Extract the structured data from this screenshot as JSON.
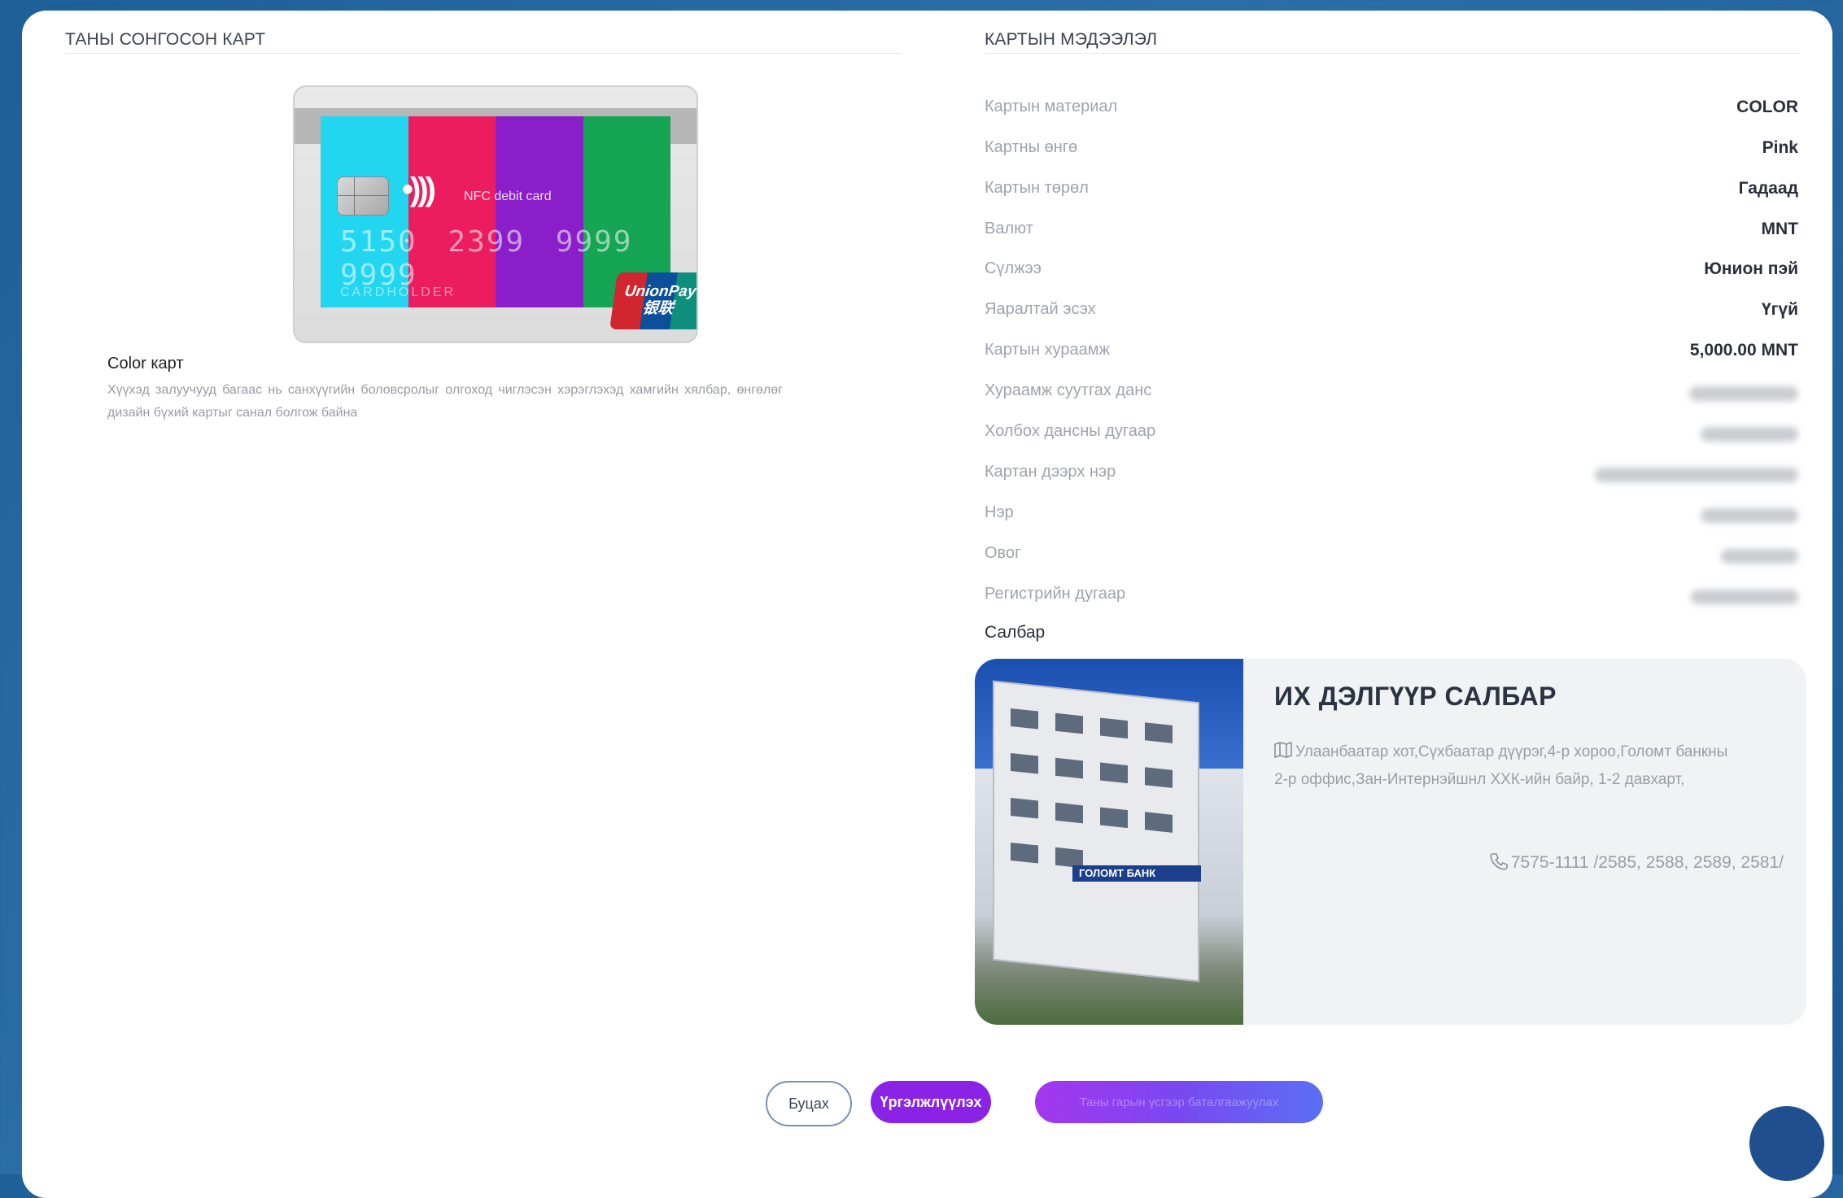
{
  "left_section": {
    "title": "ТАНЫ СОНГОСОН КАРТ",
    "card": {
      "number_groups": [
        "5150",
        "2399",
        "9999",
        "9999"
      ],
      "nfc_label": "NFC debit card",
      "holder_text": "CARDHOLDER",
      "network_logo": "UnionPay",
      "network_logo_sub": "银联",
      "stripe_colors": [
        "#22d6f0",
        "#ec1d5e",
        "#8a1fc9",
        "#16a455"
      ]
    },
    "card_name": "Color карт",
    "card_description": "Хүүхэд залуучууд багаас нь санхүүгийн боловсролыг олгоход чиглэсэн хэрэглэхэд хамгийн хялбар, өнгөлөг дизайн бүхий картыг санал болгож байна"
  },
  "right_section": {
    "title": "КАРТЫН МЭДЭЭЛЭЛ",
    "rows": [
      {
        "label": "Картын материал",
        "value": "COLOR"
      },
      {
        "label": "Картны өнгө",
        "value": "Pink"
      },
      {
        "label": "Картын төрөл",
        "value": "Гадаад"
      },
      {
        "label": "Валют",
        "value": "MNT"
      },
      {
        "label": "Сүлжээ",
        "value": "Юнион пэй"
      },
      {
        "label": "Яаралтай эсэх",
        "value": "Үгүй"
      },
      {
        "label": "Картын хураамж",
        "value": "5,000.00 MNT"
      },
      {
        "label": "Хураамж суутгах данс",
        "value": ""
      },
      {
        "label": "Холбох дансны дугаар",
        "value": ""
      },
      {
        "label": "Картан дээрх нэр",
        "value": ""
      },
      {
        "label": "Нэр",
        "value": ""
      },
      {
        "label": "Овог",
        "value": ""
      },
      {
        "label": "Регистрийн дугаар",
        "value": ""
      }
    ],
    "branch_label": "Салбар",
    "branch": {
      "name": "ИХ ДЭЛГҮҮР САЛБАР",
      "address": "Улаанбаатар хот,Сүхбаатар дүүрэг,4-р хороо,Голомт банкны 2-р оффис,Зан-Интернэйшнл ХХК-ийн байр, 1-2 давхарт,",
      "phone": "7575-1111 /2585, 2588, 2589, 2581/",
      "photo_sign": "ГОЛОМТ БАНК"
    }
  },
  "buttons": {
    "back": "Буцах",
    "continue": "Үргэлжлүүлэх",
    "confirm": "Таны гарын үсгээр баталгаажуулах"
  }
}
